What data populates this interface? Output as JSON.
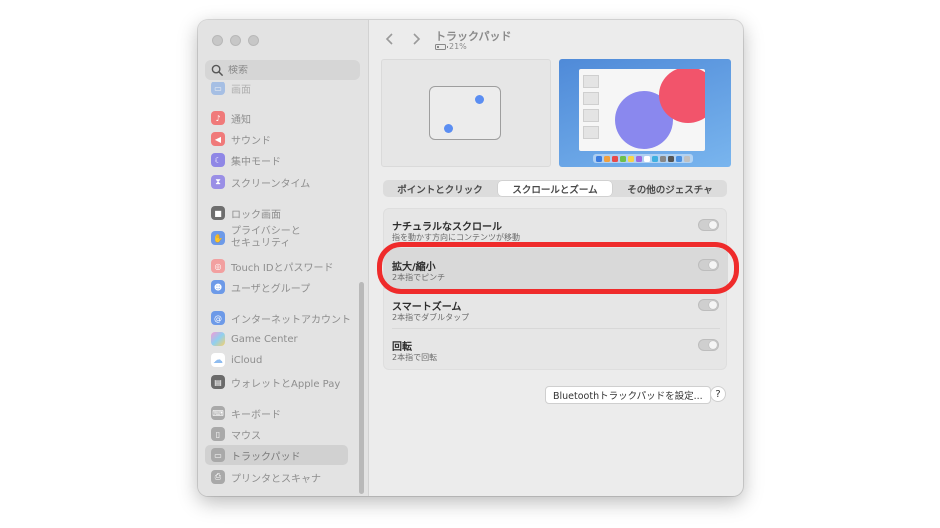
{
  "sidebar": {
    "search_placeholder": "検索",
    "items": [
      {
        "label": "画面",
        "icon": "display-icon",
        "color": "#7fa8e6"
      },
      {
        "label": "通知",
        "icon": "bell-icon",
        "color": "#f07a7a"
      },
      {
        "label": "サウンド",
        "icon": "speaker-icon",
        "color": "#f07a7a"
      },
      {
        "label": "集中モード",
        "icon": "moon-icon",
        "color": "#8f87e6"
      },
      {
        "label": "スクリーンタイム",
        "icon": "hourglass-icon",
        "color": "#9a8fe6"
      },
      {
        "label": "ロック画面",
        "icon": "lock-icon",
        "color": "#6e6e6e"
      },
      {
        "label": "プライバシーと",
        "label2": "セキュリティ",
        "icon": "hand-icon",
        "color": "#6d9ae8"
      },
      {
        "label": "Touch IDとパスワード",
        "icon": "fingerprint-icon",
        "color": "#f2a0a0"
      },
      {
        "label": "ユーザとグループ",
        "icon": "users-icon",
        "color": "#6d9ae8"
      },
      {
        "label": "インターネットアカウント",
        "icon": "at-icon",
        "color": "#6d9ae8"
      },
      {
        "label": "Game Center",
        "icon": "game-center-icon",
        "color": "#e58ac9"
      },
      {
        "label": "iCloud",
        "icon": "cloud-icon",
        "color": "#8fbcef"
      },
      {
        "label": "ウォレットとApple Pay",
        "icon": "wallet-icon",
        "color": "#6b6b6b"
      },
      {
        "label": "キーボード",
        "icon": "keyboard-icon",
        "color": "#a9a9a9"
      },
      {
        "label": "マウス",
        "icon": "mouse-icon",
        "color": "#a9a9a9"
      },
      {
        "label": "トラックパッド",
        "icon": "trackpad-icon",
        "color": "#a9a9a9"
      },
      {
        "label": "プリンタとスキャナ",
        "icon": "printer-icon",
        "color": "#a9a9a9"
      }
    ]
  },
  "header": {
    "title": "トラックパッド",
    "battery": "21%"
  },
  "tabs": [
    {
      "label": "ポイントとクリック",
      "active": false
    },
    {
      "label": "スクロールとズーム",
      "active": true
    },
    {
      "label": "その他のジェスチャ",
      "active": false
    }
  ],
  "settings": [
    {
      "title": "ナチュラルなスクロール",
      "subtitle": "指を動かす方向にコンテンツが移動"
    },
    {
      "title": "拡大/縮小",
      "subtitle": "2本指でピンチ"
    },
    {
      "title": "スマートズーム",
      "subtitle": "2本指でダブルタップ"
    },
    {
      "title": "回転",
      "subtitle": "2本指で回転"
    }
  ],
  "footer": {
    "bluetooth_button": "Bluetoothトラックパッドを設定...",
    "help_button": "?"
  },
  "accent_colors": {
    "highlight_ring": "#ef2b2b",
    "dot_blue": "#5b8ef2"
  }
}
